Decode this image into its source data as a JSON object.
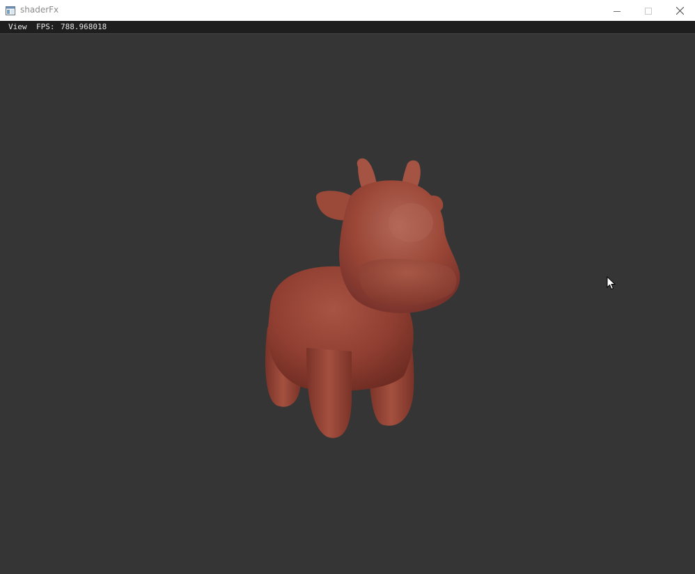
{
  "window": {
    "title": "shaderFx",
    "controls": {
      "minimize_icon": "minimize-icon",
      "maximize_icon": "maximize-icon",
      "close_icon": "close-icon"
    }
  },
  "menubar": {
    "view_label": "View",
    "fps_label": "FPS:",
    "fps_value": "788.968018"
  },
  "viewport": {
    "background": "#353535",
    "model": "cow-model",
    "model_color": "#9a4435"
  }
}
